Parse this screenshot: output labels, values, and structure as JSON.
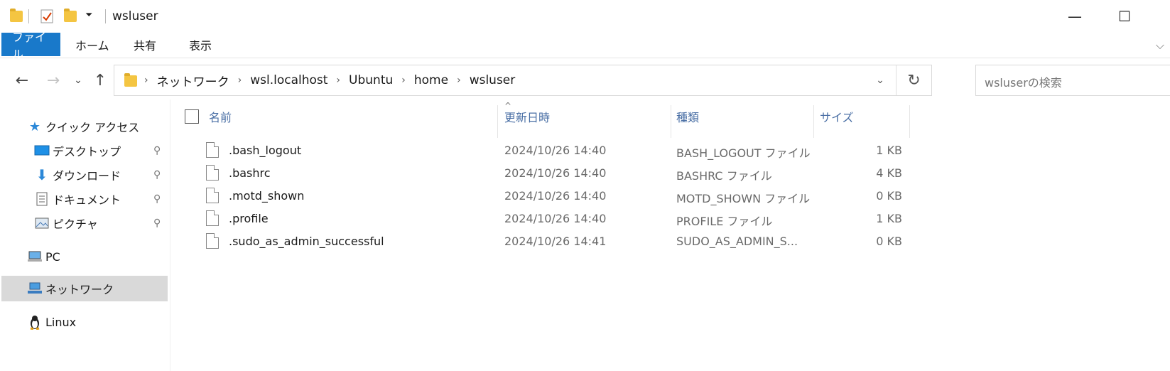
{
  "window": {
    "title": "wsluser",
    "minimize": "—",
    "maximize": "☐"
  },
  "ribbon": {
    "tabs": [
      {
        "label": "ファイル"
      },
      {
        "label": "ホーム"
      },
      {
        "label": "共有"
      },
      {
        "label": "表示"
      }
    ],
    "expand": "⌵"
  },
  "nav": {
    "back": "←",
    "forward": "→",
    "recent": "⌄",
    "up": "↑",
    "breadcrumbs": [
      "ネットワーク",
      "wsl.localhost",
      "Ubuntu",
      "home",
      "wsluser"
    ],
    "crumb_sep": "›",
    "address_dropdown": "⌄",
    "refresh": "↻",
    "search_placeholder": "wsluserの検索"
  },
  "sidebar": {
    "items": [
      {
        "label": "クイック アクセス",
        "icon": "star-icon"
      },
      {
        "label": "デスクトップ",
        "icon": "desktop-icon",
        "pinned": true
      },
      {
        "label": "ダウンロード",
        "icon": "download-icon",
        "pinned": true
      },
      {
        "label": "ドキュメント",
        "icon": "document-icon",
        "pinned": true
      },
      {
        "label": "ピクチャ",
        "icon": "pictures-icon",
        "pinned": true
      },
      {
        "label": "PC",
        "icon": "pc-icon"
      },
      {
        "label": "ネットワーク",
        "icon": "network-icon",
        "selected": true
      },
      {
        "label": "Linux",
        "icon": "linux-icon"
      }
    ],
    "pin_glyph": "📌"
  },
  "columns": {
    "name": "名前",
    "date": "更新日時",
    "type": "種類",
    "size": "サイズ",
    "sort_indicator": "^"
  },
  "files": [
    {
      "name": ".bash_logout",
      "date": "2024/10/26 14:40",
      "type": "BASH_LOGOUT ファイル",
      "size": "1 KB"
    },
    {
      "name": ".bashrc",
      "date": "2024/10/26 14:40",
      "type": "BASHRC ファイル",
      "size": "4 KB"
    },
    {
      "name": ".motd_shown",
      "date": "2024/10/26 14:40",
      "type": "MOTD_SHOWN ファイル",
      "size": "0 KB"
    },
    {
      "name": ".profile",
      "date": "2024/10/26 14:40",
      "type": "PROFILE ファイル",
      "size": "1 KB"
    },
    {
      "name": ".sudo_as_admin_successful",
      "date": "2024/10/26 14:41",
      "type": "SUDO_AS_ADMIN_S...",
      "size": "0 KB"
    }
  ],
  "colors": {
    "accent": "#1979ca",
    "selected_bg": "#d9d9d9",
    "header_text": "#4a6fa5"
  }
}
